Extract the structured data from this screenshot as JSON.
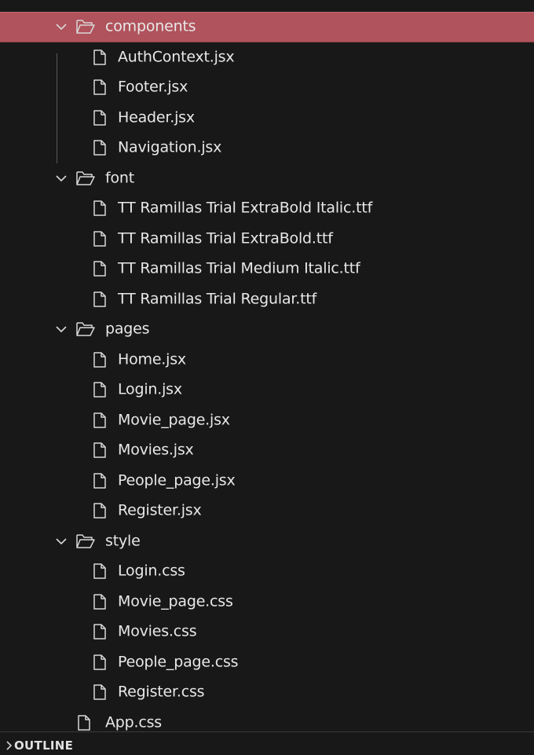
{
  "explorer": {
    "components": {
      "name": "components",
      "files": [
        "AuthContext.jsx",
        "Footer.jsx",
        "Header.jsx",
        "Navigation.jsx"
      ]
    },
    "font": {
      "name": "font",
      "files": [
        "TT Ramillas Trial ExtraBold Italic.ttf",
        "TT Ramillas Trial ExtraBold.ttf",
        "TT Ramillas Trial Medium Italic.ttf",
        "TT Ramillas Trial Regular.ttf"
      ]
    },
    "pages": {
      "name": "pages",
      "files": [
        "Home.jsx",
        "Login.jsx",
        "Movie_page.jsx",
        "Movies.jsx",
        "People_page.jsx",
        "Register.jsx"
      ]
    },
    "style": {
      "name": "style",
      "files": [
        "Login.css",
        "Movie_page.css",
        "Movies.css",
        "People_page.css",
        "Register.css"
      ]
    },
    "root_files": [
      "App.css"
    ]
  },
  "outline": {
    "label": "OUTLINE"
  },
  "colors": {
    "background": "#181818",
    "selection": "#b0535c",
    "text": "#e8e8e8"
  },
  "icons": {
    "folder": "folder-open-icon",
    "file": "file-icon",
    "expanded": "chevron-down-icon",
    "collapsed": "chevron-right-icon"
  }
}
